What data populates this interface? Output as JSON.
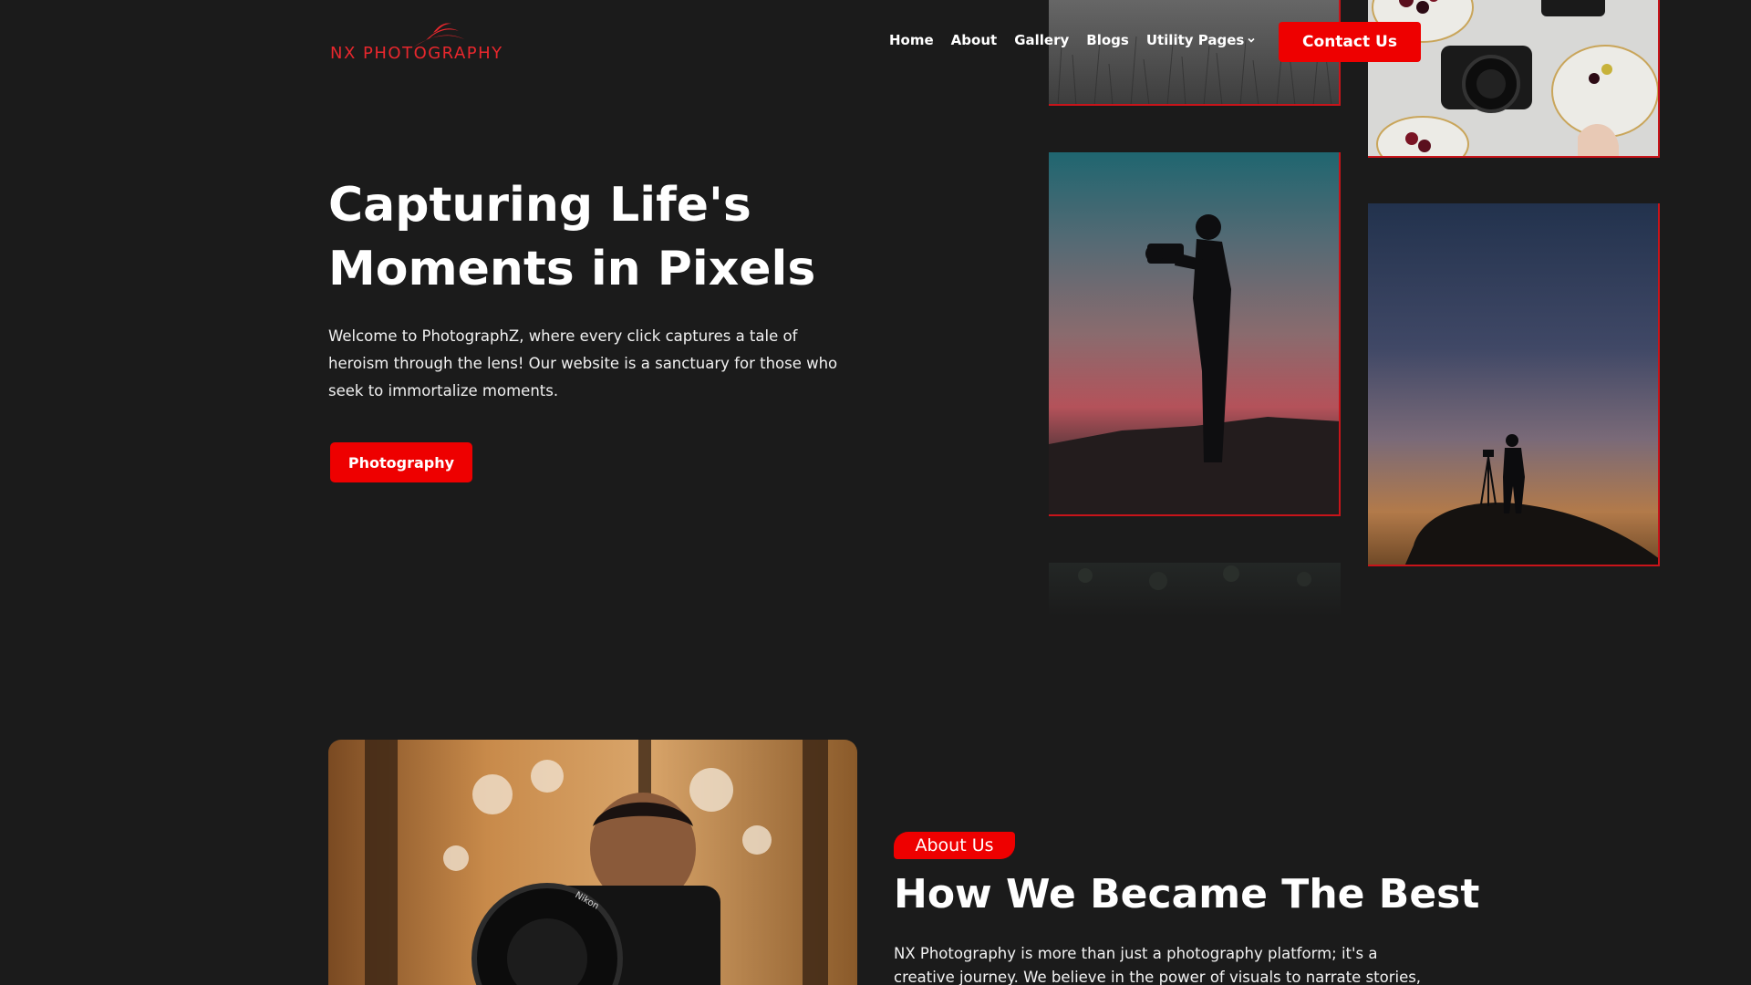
{
  "brand": {
    "logo_text": "NX PHOTOGRAPHY",
    "accent_color": "#ee0000",
    "background_color": "#1b1b1b"
  },
  "nav": {
    "items": [
      {
        "label": "Home"
      },
      {
        "label": "About"
      },
      {
        "label": "Gallery"
      },
      {
        "label": "Blogs"
      },
      {
        "label": "Utility Pages",
        "icon": "chevron-down-icon"
      }
    ],
    "contact_label": "Contact Us"
  },
  "hero": {
    "title_line1": "Capturing Life's",
    "title_line2": "Moments in Pixels",
    "description": "Welcome to PhotographZ, where every click captures a tale of heroism through the lens! Our website is a sanctuary for those who seek to immortalize moments.",
    "button_label": "Photography"
  },
  "gallery": {
    "photos": [
      {
        "subject": "grass-field"
      },
      {
        "subject": "camera-and-plates"
      },
      {
        "subject": "photographer-silhouette-sunset"
      },
      {
        "subject": "tripod-silhouette-dusk"
      },
      {
        "subject": "foliage"
      }
    ]
  },
  "about": {
    "badge": "About Us",
    "title": "How We Became The Best",
    "text": "NX Photography is more than just a photography platform; it's a creative journey. We believe in the power of visuals to narrate stories,"
  }
}
